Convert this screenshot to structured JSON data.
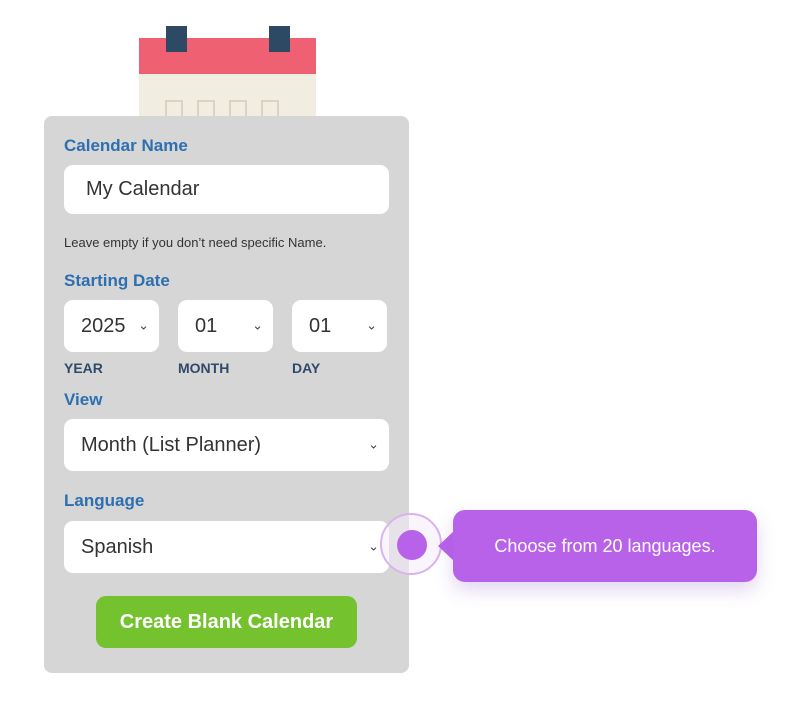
{
  "form": {
    "calendar_name_label": "Calendar Name",
    "calendar_name_value": "My Calendar",
    "calendar_name_hint": "Leave empty if you don’t need specific Name.",
    "starting_date_label": "Starting Date",
    "year_value": "2025",
    "month_value": "01",
    "day_value": "01",
    "year_label": "YEAR",
    "month_label": "MONTH",
    "day_label": "DAY",
    "view_label": "View",
    "view_value": "Month (List Planner)",
    "language_label": "Language",
    "language_value": "Spanish",
    "create_button": "Create Blank Calendar"
  },
  "tooltip": {
    "text": "Choose from 20 languages."
  },
  "icons": {
    "dropdown": "chevron-down-icon",
    "illustration": "calendar-icon"
  },
  "colors": {
    "label_blue": "#2d6fb0",
    "panel_bg": "#d6d6d6",
    "button_green": "#74c22e",
    "tooltip_purple": "#b862ea",
    "calendar_red": "#ee6072",
    "calendar_ring": "#2e4963"
  }
}
